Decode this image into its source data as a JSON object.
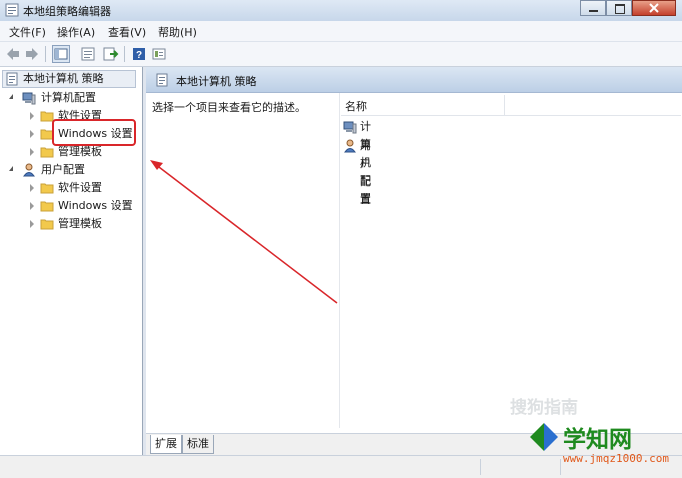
{
  "window": {
    "title": "本地组策略编辑器"
  },
  "menu": [
    "文件(F)",
    "操作(A)",
    "查看(V)",
    "帮助(H)"
  ],
  "toolbar": {
    "icons": [
      "back-icon",
      "forward-icon",
      "show-hide-tree-icon",
      "properties-icon",
      "export-icon",
      "help-icon",
      "view-icon"
    ]
  },
  "tree": {
    "root": "本地计算机 策略",
    "computer_config": "计算机配置",
    "computer_children": [
      "软件设置",
      "Windows 设置",
      "管理模板"
    ],
    "user_config": "用户配置",
    "user_children": [
      "软件设置",
      "Windows 设置",
      "管理模板"
    ]
  },
  "right_pane": {
    "header": "本地计算机 策略",
    "description": "选择一个项目来查看它的描述。",
    "column_name": "名称",
    "items": [
      "计算机配置",
      "用户配置"
    ]
  },
  "tabs": [
    "扩展",
    "标准"
  ],
  "watermark": {
    "sogou": "搜狗指南",
    "brand": "学知网",
    "url": "www.jmqz1000.com"
  },
  "colors": {
    "annotation": "#d9262a",
    "folder": "#f2c94c"
  }
}
